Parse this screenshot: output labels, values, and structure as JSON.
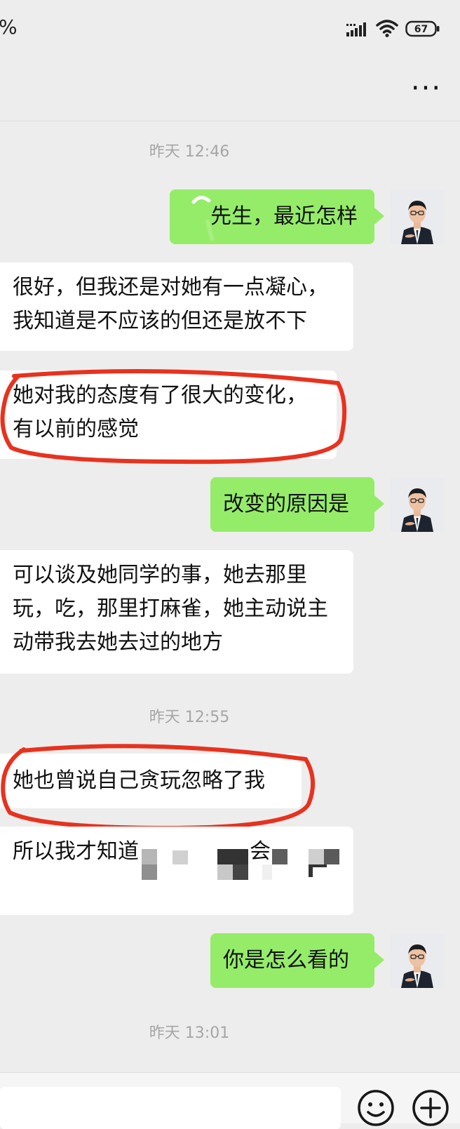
{
  "status_bar": {
    "left_glyph": "%",
    "battery_level": "67"
  },
  "header": {
    "more_label": "···"
  },
  "messages": [
    {
      "kind": "timestamp",
      "text": "昨天 12:46"
    },
    {
      "kind": "sent",
      "text": "先生，最近怎样"
    },
    {
      "kind": "received",
      "lines": [
        "很好，但我还是对她有一点凝心，",
        "我知道是不应该的但还是放不下"
      ]
    },
    {
      "kind": "received",
      "lines": [
        "她对我的态度有了很大的变化，",
        "有以前的感觉"
      ]
    },
    {
      "kind": "sent",
      "text": "改变的原因是"
    },
    {
      "kind": "received",
      "lines": [
        "可以谈及她同学的事，她去那里",
        "玩，吃，那里打麻雀，她主动说主",
        "动带我去她去过的地方"
      ]
    },
    {
      "kind": "timestamp",
      "text": "昨天 12:55"
    },
    {
      "kind": "received",
      "lines": [
        "她也曾说自己贪玩忽略了我"
      ]
    },
    {
      "kind": "received",
      "lines": [
        "所以我才知道",
        "会"
      ]
    },
    {
      "kind": "sent",
      "text": "你是怎么看的"
    },
    {
      "kind": "timestamp",
      "text": "昨天 13:01"
    }
  ],
  "colors": {
    "background": "#ededed",
    "sent_bubble": "#95ec69",
    "received_bubble": "#ffffff",
    "annotation_red": "#e8321e",
    "timestamp_text": "#a6a6a6"
  },
  "icons": {
    "signal": "signal-icon",
    "wifi": "wifi-icon",
    "battery": "battery-icon",
    "more": "more-icon",
    "emoji": "emoji-icon",
    "plus": "plus-icon"
  }
}
